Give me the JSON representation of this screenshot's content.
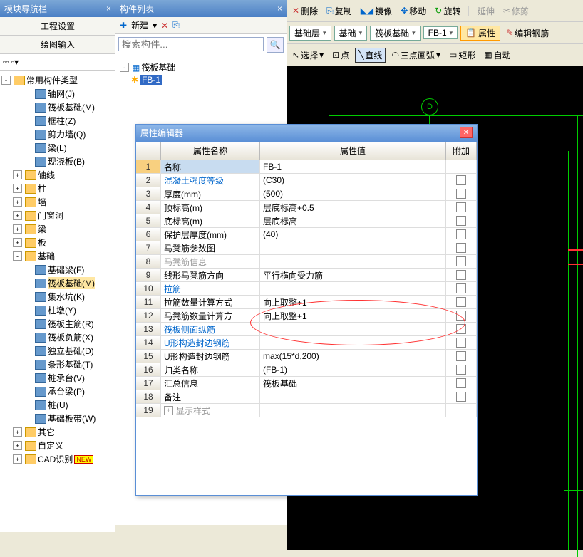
{
  "leftPanel": {
    "title": "模块导航栏",
    "tab1": "工程设置",
    "tab2": "绘图输入"
  },
  "tree": {
    "root": "常用构件类型",
    "items": [
      {
        "lvl": 2,
        "exp": "",
        "label": "轴网(J)",
        "ic": "grid"
      },
      {
        "lvl": 2,
        "exp": "",
        "label": "筏板基础(M)",
        "ic": "raft"
      },
      {
        "lvl": 2,
        "exp": "",
        "label": "框柱(Z)",
        "ic": "col"
      },
      {
        "lvl": 2,
        "exp": "",
        "label": "剪力墙(Q)",
        "ic": "wall"
      },
      {
        "lvl": 2,
        "exp": "",
        "label": "梁(L)",
        "ic": "beam"
      },
      {
        "lvl": 2,
        "exp": "",
        "label": "现浇板(B)",
        "ic": "slab"
      },
      {
        "lvl": 1,
        "exp": "+",
        "label": "轴线",
        "folder": true
      },
      {
        "lvl": 1,
        "exp": "+",
        "label": "柱",
        "folder": true
      },
      {
        "lvl": 1,
        "exp": "+",
        "label": "墙",
        "folder": true
      },
      {
        "lvl": 1,
        "exp": "+",
        "label": "门窗洞",
        "folder": true
      },
      {
        "lvl": 1,
        "exp": "+",
        "label": "梁",
        "folder": true
      },
      {
        "lvl": 1,
        "exp": "+",
        "label": "板",
        "folder": true
      },
      {
        "lvl": 1,
        "exp": "-",
        "label": "基础",
        "folder": true
      },
      {
        "lvl": 2,
        "exp": "",
        "label": "基础梁(F)",
        "ic": "b1"
      },
      {
        "lvl": 2,
        "exp": "",
        "label": "筏板基础(M)",
        "ic": "b2",
        "sel": true
      },
      {
        "lvl": 2,
        "exp": "",
        "label": "集水坑(K)",
        "ic": "b3"
      },
      {
        "lvl": 2,
        "exp": "",
        "label": "柱墩(Y)",
        "ic": "b4"
      },
      {
        "lvl": 2,
        "exp": "",
        "label": "筏板主筋(R)",
        "ic": "b5"
      },
      {
        "lvl": 2,
        "exp": "",
        "label": "筏板负筋(X)",
        "ic": "b6"
      },
      {
        "lvl": 2,
        "exp": "",
        "label": "独立基础(D)",
        "ic": "b7"
      },
      {
        "lvl": 2,
        "exp": "",
        "label": "条形基础(T)",
        "ic": "b8"
      },
      {
        "lvl": 2,
        "exp": "",
        "label": "桩承台(V)",
        "ic": "b9"
      },
      {
        "lvl": 2,
        "exp": "",
        "label": "承台梁(P)",
        "ic": "b10"
      },
      {
        "lvl": 2,
        "exp": "",
        "label": "桩(U)",
        "ic": "b11"
      },
      {
        "lvl": 2,
        "exp": "",
        "label": "基础板带(W)",
        "ic": "b12"
      },
      {
        "lvl": 1,
        "exp": "+",
        "label": "其它",
        "folder": true
      },
      {
        "lvl": 1,
        "exp": "+",
        "label": "自定义",
        "folder": true
      },
      {
        "lvl": 1,
        "exp": "+",
        "label": "CAD识别",
        "folder": true,
        "new": true
      }
    ]
  },
  "midPanel": {
    "title": "构件列表",
    "newBtn": "新建",
    "searchPlaceholder": "搜索构件...",
    "root": "筏板基础",
    "item": "FB-1"
  },
  "topToolbar": {
    "delete": "删除",
    "copy": "复制",
    "mirror": "镜像",
    "move": "移动",
    "rotate": "旋转",
    "extend": "延伸",
    "trim": "修剪"
  },
  "selRow": {
    "s1": "基础层",
    "s2": "基础",
    "s3": "筏板基础",
    "s4": "FB-1",
    "prop": "属性",
    "rebar": "编辑钢筋"
  },
  "drawRow": {
    "select": "选择",
    "point": "点",
    "line": "直线",
    "arc": "三点画弧",
    "rect": "矩形",
    "auto": "自动"
  },
  "gridLabel": "D",
  "dialog": {
    "title": "属性编辑器",
    "hName": "属性名称",
    "hVal": "属性值",
    "hAdd": "附加",
    "rows": [
      {
        "n": "1",
        "name": "名称",
        "val": "FB-1",
        "sel": true
      },
      {
        "n": "2",
        "name": "混凝土强度等级",
        "val": "(C30)",
        "blue": true,
        "chk": true
      },
      {
        "n": "3",
        "name": "厚度(mm)",
        "val": "(500)",
        "chk": true
      },
      {
        "n": "4",
        "name": "顶标高(m)",
        "val": "层底标高+0.5",
        "chk": true
      },
      {
        "n": "5",
        "name": "底标高(m)",
        "val": "层底标高",
        "chk": true
      },
      {
        "n": "6",
        "name": "保护层厚度(mm)",
        "val": "(40)",
        "chk": true
      },
      {
        "n": "7",
        "name": "马凳筋参数图",
        "val": "",
        "chk": true
      },
      {
        "n": "8",
        "name": "马凳筋信息",
        "val": "",
        "gray": true,
        "chk": true
      },
      {
        "n": "9",
        "name": "线形马凳筋方向",
        "val": "平行横向受力筋",
        "chk": true
      },
      {
        "n": "10",
        "name": "拉筋",
        "val": "",
        "blue": true,
        "chk": true
      },
      {
        "n": "11",
        "name": "拉筋数量计算方式",
        "val": "向上取整+1",
        "chk": true
      },
      {
        "n": "12",
        "name": "马凳筋数量计算方",
        "val": "向上取整+1",
        "chk": true
      },
      {
        "n": "13",
        "name": "筏板侧面纵筋",
        "val": "",
        "blue": true,
        "chk": true
      },
      {
        "n": "14",
        "name": "U形构造封边钢筋",
        "val": "",
        "blue": true,
        "chk": true
      },
      {
        "n": "15",
        "name": "U形构造封边钢筋",
        "val": "max(15*d,200)",
        "chk": true
      },
      {
        "n": "16",
        "name": "归类名称",
        "val": "(FB-1)",
        "chk": true
      },
      {
        "n": "17",
        "name": "汇总信息",
        "val": "筏板基础",
        "chk": true
      },
      {
        "n": "18",
        "name": "备注",
        "val": "",
        "chk": true
      },
      {
        "n": "19",
        "name": "显示样式",
        "val": "",
        "gray": true,
        "exp": "+"
      }
    ]
  }
}
